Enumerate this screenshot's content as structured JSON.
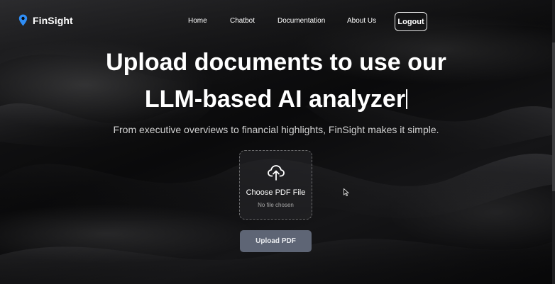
{
  "brand": {
    "name": "FinSight",
    "icon": "map-pin-icon",
    "accent": "#2f8df5"
  },
  "nav": {
    "home": "Home",
    "chatbot": "Chatbot",
    "documentation": "Documentation",
    "about": "About Us",
    "logout": "Logout"
  },
  "hero": {
    "title_line1": "Upload documents to use our",
    "title_line2": "LLM-based AI analyzer",
    "subtitle": "From executive overviews to financial highlights, FinSight makes it simple."
  },
  "upload": {
    "icon": "cloud-upload-icon",
    "choose_label": "Choose PDF File",
    "no_file": "No file chosen",
    "button_label": "Upload PDF",
    "button_color": "#5e6575"
  }
}
